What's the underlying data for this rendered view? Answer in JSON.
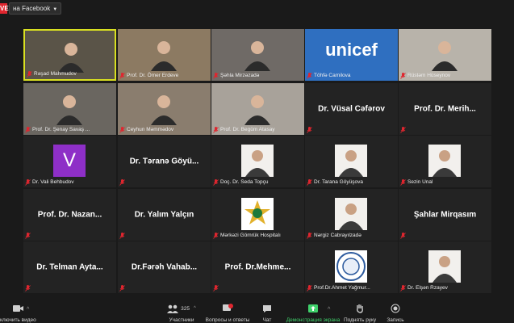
{
  "topbar": {
    "live": "VE",
    "stream_button": "на Facebook"
  },
  "tiles": [
    {
      "name": "Rəşad Mahmudov",
      "type": "video",
      "active": true
    },
    {
      "name": "Prof. Dr. Ömer Erdeve",
      "type": "video"
    },
    {
      "name": "Şəhla Mirzəzadə",
      "type": "video"
    },
    {
      "name": "Töhfə Camilova",
      "type": "unicef",
      "logo_text": "unicef"
    },
    {
      "name": "Rüstəm Hüseynov",
      "type": "video"
    },
    {
      "name": "Prof. Dr. Şenay Savaş ...",
      "type": "video"
    },
    {
      "name": "Ceyhun Məmmədov",
      "type": "video"
    },
    {
      "name": "Prof. Dr. Begüm Atasay",
      "type": "video"
    },
    {
      "name": "",
      "type": "text",
      "display": "Dr. Vüsal Cəfərov"
    },
    {
      "name": "",
      "type": "text",
      "display": "Prof. Dr. Merih..."
    },
    {
      "name": "Dr. Vali Behbudov",
      "type": "avatar",
      "letter": "V"
    },
    {
      "name": "",
      "type": "text",
      "display": "Dr. Təranə Göyü..."
    },
    {
      "name": "Doç. Dr. Seda Topçu",
      "type": "photo"
    },
    {
      "name": "Dr. Tarana Göyüşova",
      "type": "photo"
    },
    {
      "name": "Sezin Unal",
      "type": "photo"
    },
    {
      "name": "",
      "type": "text",
      "display": "Prof. Dr. Nazan..."
    },
    {
      "name": "",
      "type": "text",
      "display": "Dr. Yalım Yalçın"
    },
    {
      "name": "Mərkəzi Gömrük Hospitalı",
      "type": "emblem"
    },
    {
      "name": "Nərgiz Cabrayılzadə",
      "type": "photo"
    },
    {
      "name": "",
      "type": "text",
      "display": "Şahlar Mirqasım"
    },
    {
      "name": "",
      "type": "text",
      "display": "Dr. Telman Ayta..."
    },
    {
      "name": "",
      "type": "text",
      "display": "Dr.Fərəh Vahab..."
    },
    {
      "name": "",
      "type": "text",
      "display": "Prof. Dr.Mehme..."
    },
    {
      "name": "Prof.Dr.Ahmet Yağmur...",
      "type": "seal"
    },
    {
      "name": "Dr. Elşən Rzayev",
      "type": "photo"
    }
  ],
  "toolbar": {
    "video": "ключить видео",
    "participants": "Участники",
    "participants_count": "325",
    "qa": "Вопросы и ответы",
    "chat": "Чат",
    "share": "Демонстрация экрана",
    "raise": "Поднять руку",
    "record": "Запись"
  },
  "colors": {
    "active_border": "#d9e021",
    "share_green": "#3fd16b",
    "mute_red": "#e0262f"
  }
}
